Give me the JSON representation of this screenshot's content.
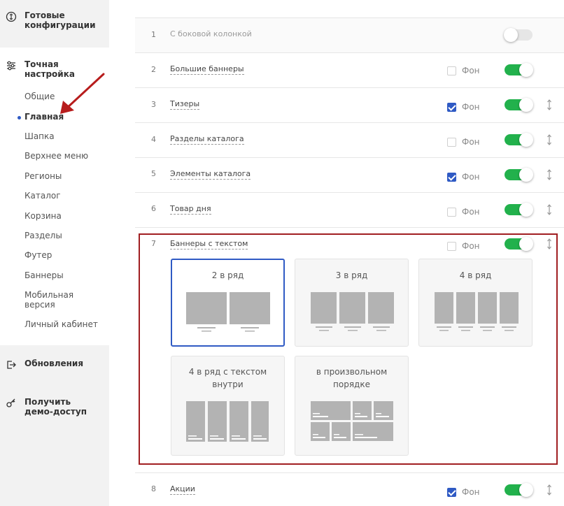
{
  "sidebar": {
    "ready_configs": "Готовые конфигурации",
    "fine_tuning": "Точная настройка",
    "items": [
      "Общие",
      "Главная",
      "Шапка",
      "Верхнее меню",
      "Регионы",
      "Каталог",
      "Корзина",
      "Разделы",
      "Футер",
      "Баннеры",
      "Мобильная версия",
      "Личный кабинет"
    ],
    "updates": "Обновления",
    "demo": "Получить демо-доступ"
  },
  "rows": [
    {
      "num": "1",
      "title": "С боковой колонкой",
      "enabled": false
    },
    {
      "num": "2",
      "title": "Большие баннеры",
      "fon": "Фон",
      "fon_checked": false,
      "enabled": true
    },
    {
      "num": "3",
      "title": "Тизеры",
      "fon": "Фон",
      "fon_checked": true,
      "enabled": true
    },
    {
      "num": "4",
      "title": "Разделы каталога",
      "fon": "Фон",
      "fon_checked": false,
      "enabled": true
    },
    {
      "num": "5",
      "title": "Элементы каталога",
      "fon": "Фон",
      "fon_checked": true,
      "enabled": true
    },
    {
      "num": "6",
      "title": "Товар дня",
      "fon": "Фон",
      "fon_checked": false,
      "enabled": true
    },
    {
      "num": "7",
      "title": "Баннеры с текстом",
      "fon": "Фон",
      "fon_checked": false,
      "enabled": true
    },
    {
      "num": "8",
      "title": "Акции",
      "fon": "Фон",
      "fon_checked": true,
      "enabled": true
    }
  ],
  "layout_options": {
    "two": "2 в ряд",
    "three": "3 в ряд",
    "four": "4 в ряд",
    "four_text_1": "4 в ряд с текстом",
    "four_text_2": "внутри",
    "custom_1": "в произвольном",
    "custom_2": "порядке",
    "selected": "2 в ряд"
  },
  "colors": {
    "accent": "#2f5ac4",
    "toggle_on": "#22b14c",
    "highlight": "#a01e21",
    "arrow": "#b71c1c"
  }
}
